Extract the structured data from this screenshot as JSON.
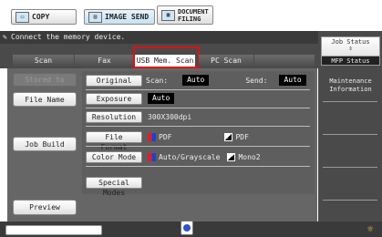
{
  "top_buttons": {
    "copy": "COPY",
    "image_send": "IMAGE SEND",
    "document_filing_line1": "DOCUMENT",
    "document_filing_line2": "FILING"
  },
  "message": "Connect the memory device.",
  "tabs": [
    {
      "label": "Scan",
      "active": false
    },
    {
      "label": "Fax",
      "active": false
    },
    {
      "label": "USB Mem. Scan",
      "active": true
    },
    {
      "label": "PC Scan",
      "active": false
    }
  ],
  "left_buttons": {
    "stored_to": "Stored to",
    "file_name": "File Name",
    "job_build": "Job Build",
    "preview": "Preview"
  },
  "settings": {
    "original": {
      "label": "Original",
      "scan_label": "Scan:",
      "scan_value": "Auto",
      "send_label": "Send:",
      "send_value": "Auto"
    },
    "exposure": {
      "label": "Exposure",
      "value": "Auto"
    },
    "resolution": {
      "label": "Resolution",
      "value": "300X300dpi"
    },
    "file_format": {
      "label": "File Format",
      "color_value": "PDF",
      "mono_value": "PDF"
    },
    "color_mode": {
      "label": "Color Mode",
      "color_value": "Auto/Grayscale",
      "mono_value": "Mono2"
    },
    "special_modes": {
      "label": "Special Modes"
    }
  },
  "right_panel": {
    "job_status": "Job Status",
    "mfp_status": "MFP Status",
    "maintenance_line1": "Maintenance",
    "maintenance_line2": "Information"
  },
  "colors": {
    "highlight": "#e01010",
    "panel": "#666666",
    "dark": "#3a3a3a"
  }
}
